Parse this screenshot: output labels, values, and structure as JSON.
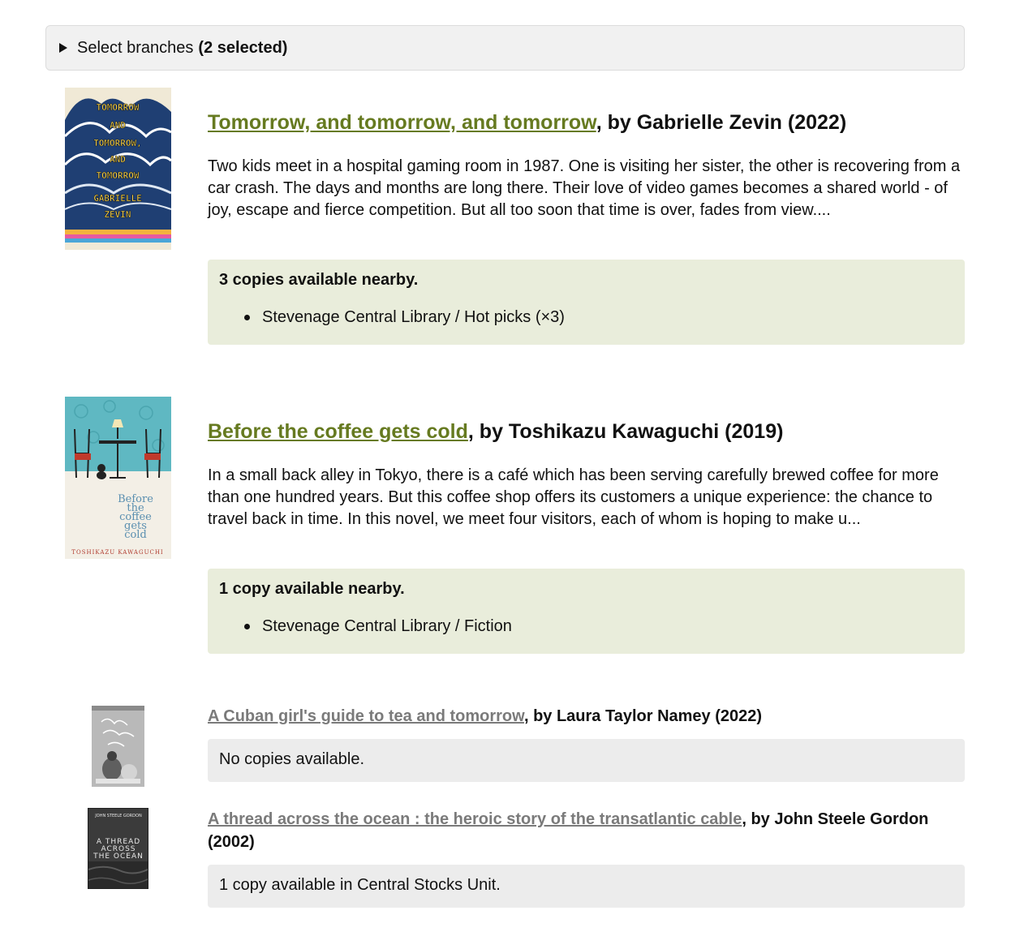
{
  "filter": {
    "label": "Select branches",
    "count_label": "(2 selected)"
  },
  "books": [
    {
      "title": "Tomorrow, and tomorrow, and tomorrow",
      "byline": ", by Gabrielle Zevin (2022)",
      "cover_text": [
        "TOMORROW",
        "AND",
        "TOMORROW,",
        "AND",
        "TOMORROW",
        "GABRIELLE",
        "ZEVIN"
      ],
      "description": "Two kids meet in a hospital gaming room in 1987. One is visiting her sister, the other is recovering from a car crash. The days and months are long there. Their love of video games becomes a shared world - of joy, escape and fierce competition. But all too soon that time is over, fades from view....",
      "availability": "3 copies available nearby.",
      "locations": [
        "Stevenage Central Library / Hot picks (×3)"
      ]
    },
    {
      "title": "Before the coffee gets cold",
      "byline": ", by Toshikazu Kawaguchi (2019)",
      "cover_text": [
        "Before",
        "the",
        "coffee",
        "gets",
        "cold",
        "TOSHIKAZU KAWAGUCHI"
      ],
      "description": "In a small back alley in Tokyo, there is a café which has been serving carefully brewed coffee for more than one hundred years. But this coffee shop offers its customers a unique experience: the chance to travel back in time. In this novel, we meet four visitors, each of whom is hoping to make u...",
      "availability": "1 copy available nearby.",
      "locations": [
        "Stevenage Central Library / Fiction"
      ]
    },
    {
      "title": "A Cuban girl's guide to tea and tomorrow",
      "byline": ", by Laura Taylor Namey (2022)",
      "availability": "No copies available."
    },
    {
      "title": "A thread across the ocean : the heroic story of the transatlantic cable",
      "byline": ", by John Steele Gordon (2002)",
      "cover_text": [
        "JOHN STEELE GORDON",
        "A THREAD",
        "ACROSS",
        "THE OCEAN"
      ],
      "availability": "1 copy available in Central Stocks Unit."
    }
  ],
  "colors": {
    "link_active": "#667a20",
    "link_inactive": "#7a7a7a",
    "available_bg": "#e9eddb",
    "unavailable_bg": "#ececec"
  }
}
